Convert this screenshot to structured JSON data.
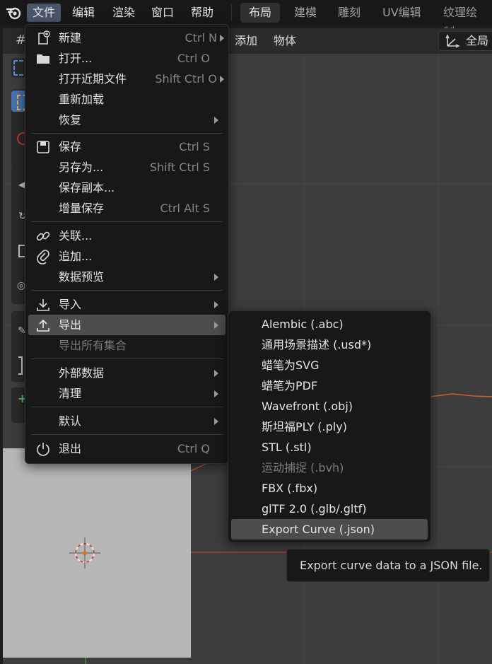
{
  "app": {
    "logo_icon": "blender-logo-icon"
  },
  "topbar": {
    "menus": [
      "文件",
      "编辑",
      "渲染",
      "窗口",
      "帮助"
    ],
    "workspaces": [
      "布局",
      "建模",
      "雕刻",
      "UV编辑",
      "纹理绘制"
    ]
  },
  "viewport_header": {
    "add": "添加",
    "object": "物体",
    "orientation": "全局"
  },
  "file_menu": {
    "items": [
      {
        "label": "新建",
        "shortcut": "Ctrl N",
        "icon": "new-file-icon",
        "submenu": true
      },
      {
        "label": "打开...",
        "shortcut": "Ctrl O",
        "icon": "folder-icon"
      },
      {
        "label": "打开近期文件",
        "shortcut": "Shift Ctrl O",
        "submenu": true
      },
      {
        "label": "重新加载"
      },
      {
        "label": "恢复",
        "submenu": true
      },
      {
        "label": "保存",
        "shortcut": "Ctrl S",
        "icon": "save-icon"
      },
      {
        "label": "另存为...",
        "shortcut": "Shift Ctrl S"
      },
      {
        "label": "保存副本..."
      },
      {
        "label": "增量保存",
        "shortcut": "Ctrl Alt S"
      },
      {
        "label": "关联...",
        "icon": "link-icon"
      },
      {
        "label": "追加...",
        "icon": "append-icon"
      },
      {
        "label": "数据预览",
        "submenu": true
      },
      {
        "label": "导入",
        "icon": "import-icon",
        "submenu": true
      },
      {
        "label": "导出",
        "icon": "export-icon",
        "submenu": true
      },
      {
        "label": "导出所有集合",
        "disabled": true
      },
      {
        "label": "外部数据",
        "submenu": true
      },
      {
        "label": "清理",
        "submenu": true
      },
      {
        "label": "默认",
        "submenu": true
      },
      {
        "label": "退出",
        "shortcut": "Ctrl Q",
        "icon": "power-icon"
      }
    ]
  },
  "export_menu": {
    "items": [
      {
        "label": "Alembic (.abc)"
      },
      {
        "label": "通用场景描述 (.usd*)"
      },
      {
        "label": "蜡笔为SVG"
      },
      {
        "label": "蜡笔为PDF"
      },
      {
        "label": "Wavefront (.obj)"
      },
      {
        "label": "斯坦福PLY (.ply)"
      },
      {
        "label": "STL (.stl)"
      },
      {
        "label": "运动捕捉 (.bvh)",
        "disabled": true
      },
      {
        "label": "FBX (.fbx)"
      },
      {
        "label": "glTF 2.0 (.glb/.gltf)"
      },
      {
        "label": "Export Curve (.json)",
        "highlighted": true
      }
    ]
  },
  "tooltip": {
    "text": "Export curve data to a JSON file."
  },
  "colors": {
    "accent": "#4772b3",
    "menu_bg": "#181818",
    "highlight": "#4d4d4d",
    "axis_x": "#c0392b"
  }
}
